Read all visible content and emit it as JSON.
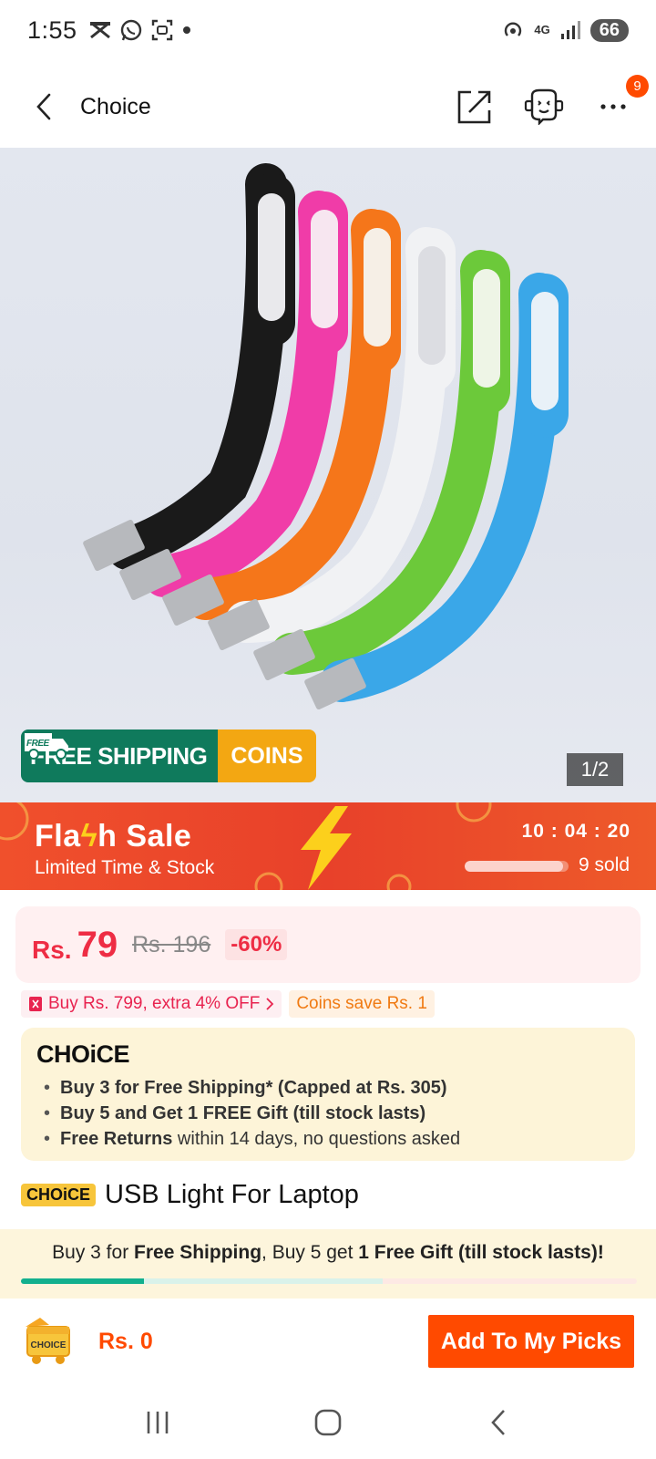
{
  "status_bar": {
    "time": "1:55",
    "network": "4G",
    "battery": "66",
    "left_icons": [
      "cast-icon",
      "whatsapp-icon",
      "screenshot-icon",
      "dot-icon"
    ]
  },
  "header": {
    "title": "Choice",
    "notification_count": "9"
  },
  "gallery": {
    "pager": "1/2",
    "shipping_badge": {
      "free_tag": "FREE",
      "label": "FREE SHIPPING",
      "coins": "COINS"
    }
  },
  "flash_sale": {
    "title": "Fla",
    "title_mid": "h",
    "title_end": "Sale",
    "subtitle": "Limited Time & Stock",
    "timer": "10 : 04 : 20",
    "sold": "9 sold",
    "sold_fraction": 0.95
  },
  "price": {
    "currency": "Rs.",
    "value": "79",
    "original": "Rs. 196",
    "discount": "-60%"
  },
  "promos": {
    "offer": "Buy Rs. 799, extra 4% OFF",
    "coins": "Coins save Rs. 1"
  },
  "choice_box": {
    "logo": "CHOiCE",
    "items": [
      {
        "bold": "Buy 3 for  Free Shipping* (Capped at Rs. 305)",
        "rest": ""
      },
      {
        "bold": "Buy 5 and Get 1 FREE Gift (till stock lasts)",
        "rest": ""
      },
      {
        "bold": "Free Returns",
        "rest": " within 14 days, no questions asked"
      }
    ]
  },
  "product": {
    "tag": "CHOiCE",
    "title": "USB Light For Laptop"
  },
  "bundle": {
    "p1": "Buy 3 for ",
    "b1": "Free Shipping",
    "p2": ", Buy 5 get ",
    "b2": "1 Free Gift (till stock lasts)!",
    "progress_fraction": 0.2
  },
  "action_bar": {
    "cart_label": "CHOICE",
    "total": "Rs. 0",
    "button": "Add To My Picks"
  },
  "colors": {
    "accent": "#ff4a00",
    "price": "#ee2d44",
    "choice_yellow": "#f7c53b",
    "shipping_green": "#0f7a5c"
  }
}
